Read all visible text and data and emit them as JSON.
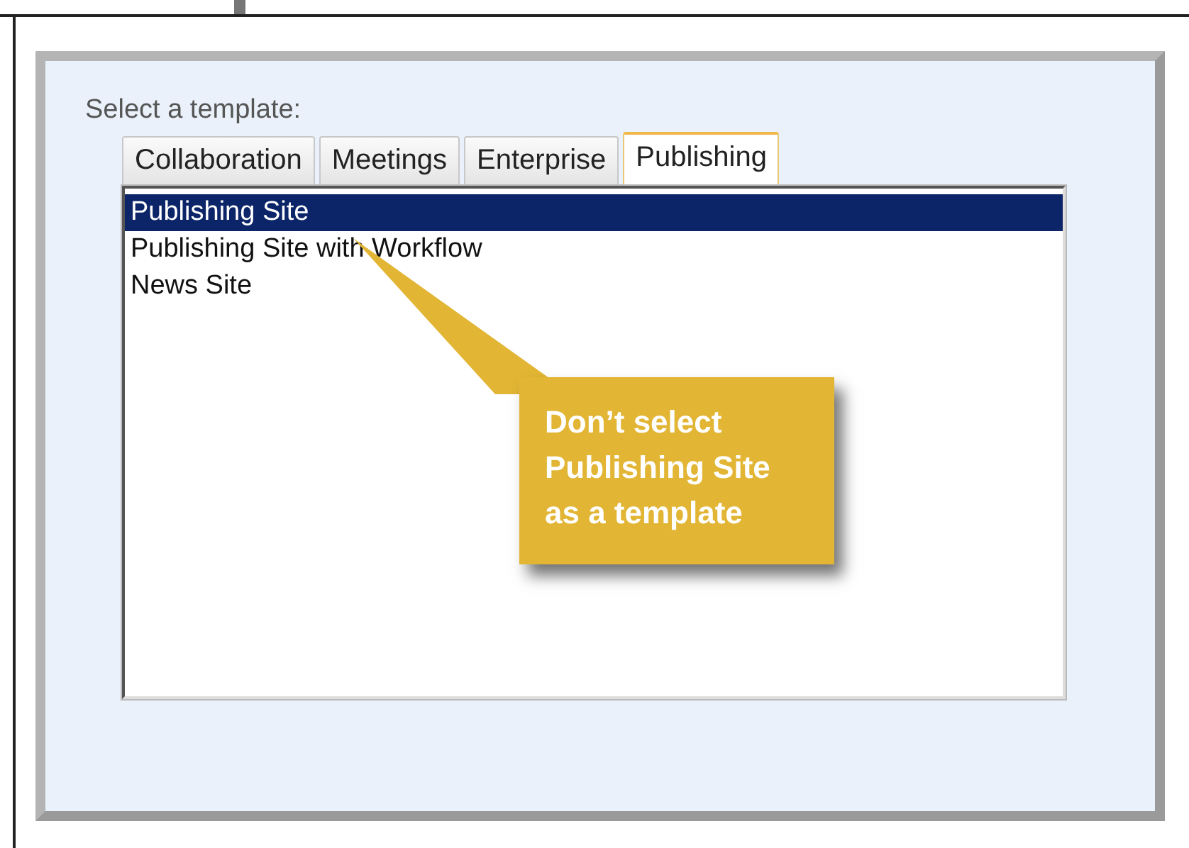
{
  "label": "Select a template:",
  "tabs": [
    {
      "label": "Collaboration",
      "selected": false
    },
    {
      "label": "Meetings",
      "selected": false
    },
    {
      "label": "Enterprise",
      "selected": false
    },
    {
      "label": "Publishing",
      "selected": true
    }
  ],
  "templates": [
    {
      "label": "Publishing Site",
      "selected": true
    },
    {
      "label": "Publishing Site with Workflow",
      "selected": false
    },
    {
      "label": "News Site",
      "selected": false
    }
  ],
  "callout": {
    "text": "Don’t select Publishing Site as a template"
  }
}
